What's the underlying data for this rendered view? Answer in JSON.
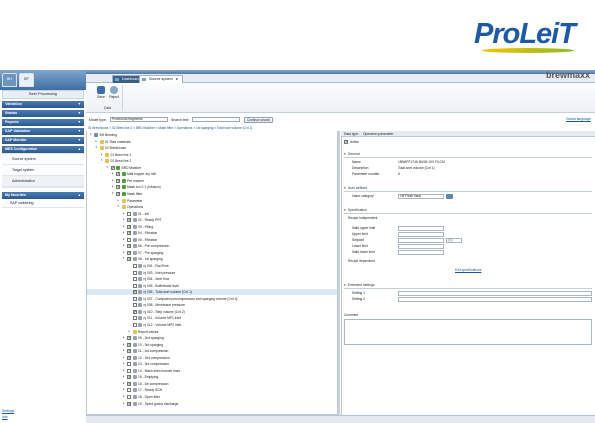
{
  "brand": {
    "logo": "ProLeiT",
    "product": "brewmaxx"
  },
  "left": {
    "tabs": [
      "BH",
      "BP"
    ],
    "title": "Beer Processing",
    "sections": [
      {
        "label": "Validation"
      },
      {
        "label": "Statuts"
      },
      {
        "label": "Reports"
      },
      {
        "label": "SAP Validation"
      },
      {
        "label": "SAP Monitor"
      },
      {
        "label": "MES Configuration"
      }
    ],
    "mes_items": [
      "Source system",
      "Target system",
      "Administration"
    ],
    "favorites": {
      "label": "My favorites",
      "items": [
        "SAP validering"
      ]
    },
    "footer": [
      "Settings",
      "Info"
    ]
  },
  "tabs": [
    {
      "label": "Dashboard"
    },
    {
      "label": "Source system",
      "close": "x"
    }
  ],
  "ribbon": {
    "save": "Save",
    "reject": "Reject",
    "group": "Data",
    "user_guide": "Global language"
  },
  "filter": {
    "model_type_label": "Model type:",
    "model_type_value": "Procedural fragments",
    "search_label": "Search text:",
    "search_value": "",
    "continue_label": "Continue search"
  },
  "breadcrumb": "01 Brewhouse > 02 Brew line 2 > BRD Maisher > Mash filter > Operations > 1st sparging > Total wort volume (Cnt 1)",
  "tree": [
    {
      "t": "",
      "label": "BH Brewing",
      "lvl": 0,
      "tw": "-",
      "icon": "root"
    },
    {
      "t": "",
      "label": "01 Raw materials",
      "lvl": 1,
      "tw": "+",
      "icon": "folder"
    },
    {
      "t": "",
      "label": "02 Brewhouse",
      "lvl": 1,
      "tw": "-",
      "icon": "folder"
    },
    {
      "t": "",
      "label": "01 Brew line 1",
      "lvl": 2,
      "tw": "+",
      "icon": "folder"
    },
    {
      "t": "",
      "label": "02 Brew line 2",
      "lvl": 2,
      "tw": "-",
      "icon": "folder"
    },
    {
      "t": "",
      "label": "BRD Maisher",
      "lvl": 3,
      "tw": "-",
      "icon": "obj",
      "cb": true
    },
    {
      "t": "",
      "label": "Malt hopper dry mill",
      "lvl": 4,
      "tw": "+",
      "icon": "obj",
      "cb": true
    },
    {
      "t": "",
      "label": "Pre masher",
      "lvl": 4,
      "tw": "+",
      "icon": "obj",
      "cb": true
    },
    {
      "t": "",
      "label": "Mash tun 2.1 (Infusion)",
      "lvl": 4,
      "tw": "+",
      "icon": "obj",
      "cb": true
    },
    {
      "t": "",
      "label": "Mash filter",
      "lvl": 4,
      "tw": "-",
      "icon": "obj",
      "cb": true
    },
    {
      "t": "",
      "label": "Parameter",
      "lvl": 5,
      "tw": "+",
      "icon": "folder"
    },
    {
      "t": "",
      "label": "Operations",
      "lvl": 5,
      "tw": "-",
      "icon": "folder"
    },
    {
      "t": "",
      "label": "01 - Init",
      "lvl": 6,
      "tw": "+",
      "icon": "leaf",
      "cb": false
    },
    {
      "t": "",
      "label": "02 - Ready PRT",
      "lvl": 6,
      "tw": "+",
      "icon": "leaf",
      "cb": true
    },
    {
      "t": "",
      "label": "03 - Filling",
      "lvl": 6,
      "tw": "+",
      "icon": "leaf",
      "cb": true
    },
    {
      "t": "",
      "label": "04 - Filtration",
      "lvl": 6,
      "tw": "+",
      "icon": "leaf",
      "cb": true
    },
    {
      "t": "",
      "label": "05 - Filtration",
      "lvl": 6,
      "tw": "+",
      "icon": "leaf",
      "cb": false
    },
    {
      "t": "",
      "label": "06 - Pre compression",
      "lvl": 6,
      "tw": "+",
      "icon": "leaf",
      "cb": true
    },
    {
      "t": "",
      "label": "07 - Pre sparging",
      "lvl": 6,
      "tw": "+",
      "icon": "leaf",
      "cb": true
    },
    {
      "t": "",
      "label": "08 - 1st sparging",
      "lvl": 6,
      "tw": "-",
      "icon": "leaf",
      "cb": true
    },
    {
      "t": "",
      "label": "nj 001 - RunTime",
      "lvl": 7,
      "tw": "",
      "icon": "leaf",
      "cb": false
    },
    {
      "t": "",
      "label": "nj 003 - Inlet pressure",
      "lvl": 7,
      "tw": "",
      "icon": "leaf",
      "cb": false
    },
    {
      "t": "",
      "label": "nj 004 - Wort flow",
      "lvl": 7,
      "tw": "",
      "icon": "leaf",
      "cb": false
    },
    {
      "t": "",
      "label": "nj 005 - Bufferbank level",
      "lvl": 7,
      "tw": "",
      "icon": "leaf",
      "cb": false
    },
    {
      "t": "",
      "label": "nj 006 - Total wort volume (Cnt 1)",
      "lvl": 7,
      "tw": "",
      "icon": "leaf",
      "cb": true,
      "sel": true
    },
    {
      "t": "",
      "label": "nj 007 - Computed precompression and sparging volume (Cnt 3)",
      "lvl": 7,
      "tw": "",
      "icon": "leaf",
      "cb": false
    },
    {
      "t": "",
      "label": "nj 008 - Membrane pressure",
      "lvl": 7,
      "tw": "",
      "icon": "leaf",
      "cb": false
    },
    {
      "t": "",
      "label": "nj 010 - Step volume (Cnt 2)",
      "lvl": 7,
      "tw": "",
      "icon": "leaf",
      "cb": true
    },
    {
      "t": "",
      "label": "nj 011 - Volume MP1 inlet",
      "lvl": 7,
      "tw": "",
      "icon": "leaf",
      "cb": false
    },
    {
      "t": "",
      "label": "nj 012 - Volume MP2 inlet",
      "lvl": 7,
      "tw": "",
      "icon": "leaf",
      "cb": false
    },
    {
      "t": "",
      "label": "Report values",
      "lvl": 7,
      "tw": "+",
      "icon": "folder"
    },
    {
      "t": "",
      "label": "09 - 2nd sparging",
      "lvl": 6,
      "tw": "+",
      "icon": "leaf",
      "cb": true
    },
    {
      "t": "",
      "label": "10 - 3rd sparging",
      "lvl": 6,
      "tw": "+",
      "icon": "leaf",
      "cb": true
    },
    {
      "t": "",
      "label": "11 - 1st compression",
      "lvl": 6,
      "tw": "+",
      "icon": "leaf",
      "cb": true
    },
    {
      "t": "",
      "label": "12 - 2nd compression",
      "lvl": 6,
      "tw": "+",
      "icon": "leaf",
      "cb": true
    },
    {
      "t": "",
      "label": "13 - 3rd compression",
      "lvl": 6,
      "tw": "+",
      "icon": "leaf",
      "cb": false
    },
    {
      "t": "",
      "label": "14 - Mash inlet channel rinse",
      "lvl": 6,
      "tw": "+",
      "icon": "leaf",
      "cb": false
    },
    {
      "t": "",
      "label": "15 - Emptying",
      "lvl": 6,
      "tw": "+",
      "icon": "leaf",
      "cb": true
    },
    {
      "t": "",
      "label": "16 - De compression",
      "lvl": 6,
      "tw": "+",
      "icon": "leaf",
      "cb": true
    },
    {
      "t": "",
      "label": "17 - Ready SGH",
      "lvl": 6,
      "tw": "+",
      "icon": "leaf",
      "cb": false
    },
    {
      "t": "",
      "label": "18 - Open filter",
      "lvl": 6,
      "tw": "+",
      "icon": "leaf",
      "cb": false
    },
    {
      "t": "",
      "label": "19 - Spent grains discharge",
      "lvl": 6,
      "tw": "+",
      "icon": "leaf",
      "cb": true
    }
  ],
  "detail": {
    "header_label": "Data type:",
    "header_value": "Operation parameter",
    "active": "Active",
    "general": {
      "title": "General",
      "rows": [
        {
          "k": "Name",
          "v": "1BN6PF1746 5N/06 100 FILCM"
        },
        {
          "k": "Description",
          "v": "Total wort volume (Cnt 1)"
        },
        {
          "k": "Parameter number",
          "v": "6"
        }
      ]
    },
    "user_defined": {
      "title": "User-defined",
      "category_label": "Value category",
      "category_value": "Off Peak Vault"
    },
    "specification": {
      "title": "Specification",
      "recipe_independent": "Recipe independent",
      "rows": [
        "Valid upper limit",
        "Upper limit",
        "Setpoint",
        "Lower limit",
        "Valid lower limit"
      ],
      "unit": "[hl]",
      "recipe_dependent": "Recipe dependent",
      "edit_link": "Edit specifications"
    },
    "extended": {
      "title": "Extended settings",
      "rows": [
        "Setting 1",
        "Setting 2"
      ]
    },
    "comment": "Comment"
  },
  "colors": {
    "brand_blue": "#1d5aa6",
    "nav_blue": "#2c5a8f",
    "accent_yellow": "#f6c400"
  }
}
